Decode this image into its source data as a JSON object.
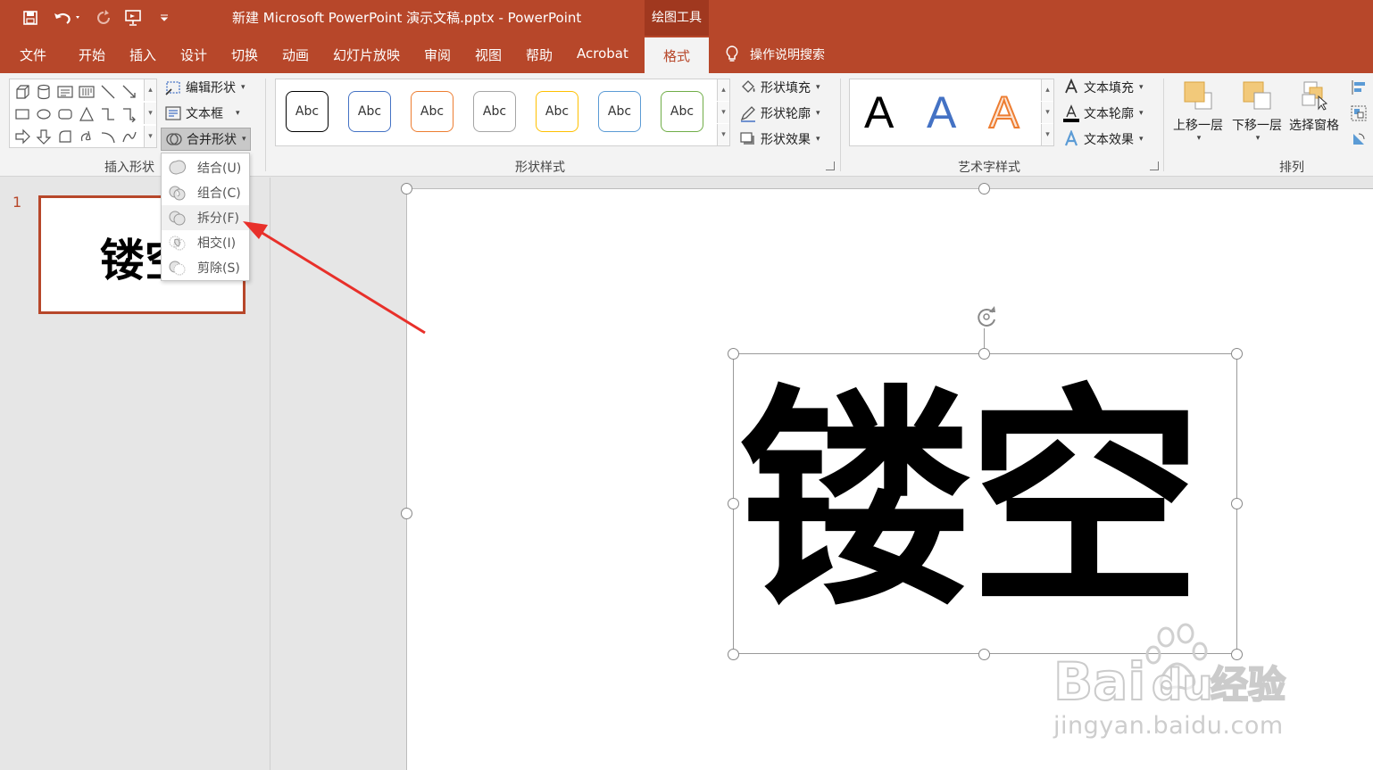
{
  "window": {
    "title": "新建 Microsoft PowerPoint 演示文稿.pptx  -  PowerPoint",
    "context_tab_header": "绘图工具"
  },
  "quick_access": [
    "save-icon",
    "undo-icon",
    "redo-icon",
    "start-presentation-icon",
    "customize-icon"
  ],
  "tabs": [
    "文件",
    "开始",
    "插入",
    "设计",
    "切换",
    "动画",
    "幻灯片放映",
    "审阅",
    "视图",
    "帮助",
    "Acrobat"
  ],
  "active_tab": "格式",
  "tell_me": "操作说明搜索",
  "ribbon": {
    "insert_shapes": {
      "label": "插入形状",
      "edit_shape": "编辑形状",
      "text_box": "文本框",
      "merge_shapes": "合并形状"
    },
    "shape_styles": {
      "label": "形状样式",
      "presets": [
        "Abc",
        "Abc",
        "Abc",
        "Abc",
        "Abc",
        "Abc",
        "Abc"
      ],
      "preset_colors": [
        "#000000",
        "#4472c4",
        "#ed7d31",
        "#a5a5a5",
        "#ffc000",
        "#5b9bd5",
        "#70ad47"
      ],
      "fill": "形状填充",
      "outline": "形状轮廓",
      "effects": "形状效果"
    },
    "wordart_styles": {
      "label": "艺术字样式",
      "samples": [
        "A",
        "A",
        "A"
      ],
      "text_fill": "文本填充",
      "text_outline": "文本轮廓",
      "text_effects": "文本效果"
    },
    "arrange": {
      "label": "排列",
      "bring_forward": "上移一层",
      "send_backward": "下移一层",
      "selection_pane": "选择窗格"
    }
  },
  "merge_menu": {
    "items": [
      "结合(U)",
      "组合(C)",
      "拆分(F)",
      "相交(I)",
      "剪除(S)"
    ],
    "highlighted": "拆分(F)"
  },
  "thumbnails": [
    {
      "number": "1",
      "text": "镂空"
    }
  ],
  "slide": {
    "text": "镂空"
  },
  "watermark": {
    "domain": "jingyan.baidu.com"
  },
  "colors": {
    "accent": "#b7472a",
    "ribbon_bg": "#f3f3f3",
    "workspace_bg": "#e6e6e6",
    "annotation_arrow": "#e8302a"
  }
}
